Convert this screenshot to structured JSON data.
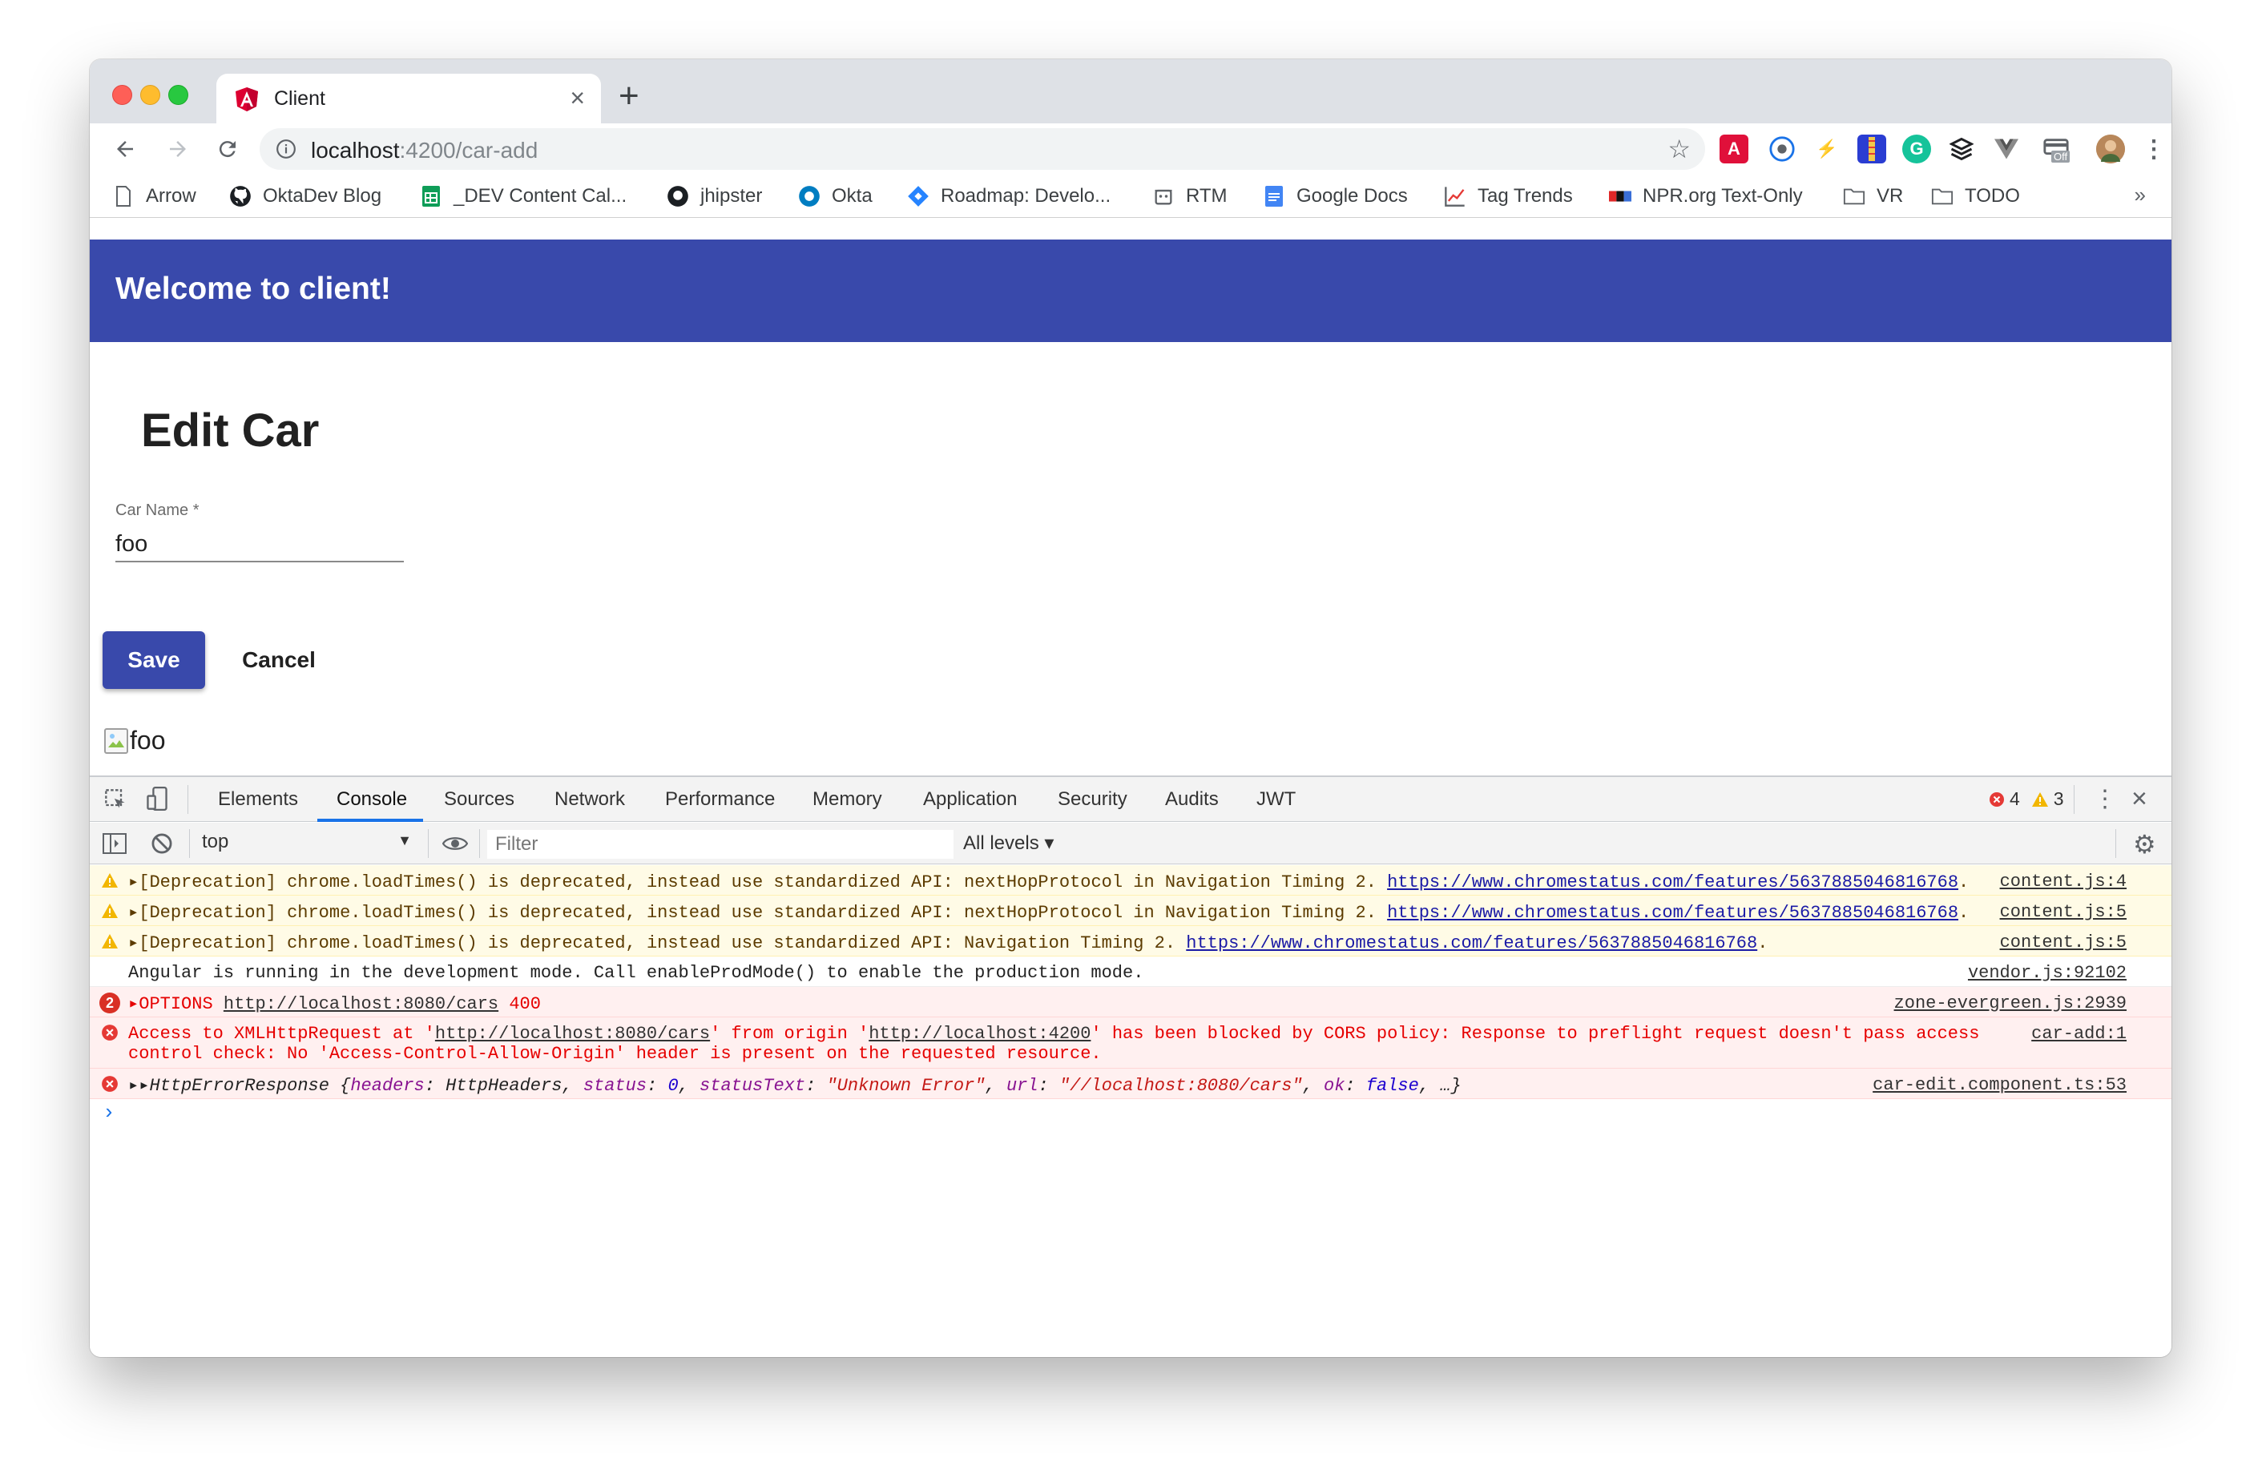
{
  "browser": {
    "tab_title": "Client",
    "new_tab": "+",
    "url_host": "localhost",
    "url_rest": ":4200/car-add",
    "bookmarks": [
      {
        "label": "Arrow",
        "icon": "page-icon"
      },
      {
        "label": "OktaDev Blog",
        "icon": "github-icon"
      },
      {
        "label": "_DEV Content Cal...",
        "icon": "sheets-icon"
      },
      {
        "label": "jhipster",
        "icon": "github-icon"
      },
      {
        "label": "Okta",
        "icon": "okta-icon"
      },
      {
        "label": "Roadmap: Develo...",
        "icon": "jira-icon"
      },
      {
        "label": "RTM",
        "icon": "rtm-icon"
      },
      {
        "label": "Google Docs",
        "icon": "docs-icon"
      },
      {
        "label": "Tag Trends",
        "icon": "chart-icon"
      },
      {
        "label": "NPR.org Text-Only",
        "icon": "npr-icon"
      },
      {
        "label": "VR",
        "icon": "folder-icon"
      },
      {
        "label": "TODO",
        "icon": "folder-icon"
      }
    ],
    "bookmarks_more": "»",
    "extension_off_label": "Off"
  },
  "app": {
    "header_title": "Welcome to client!",
    "page_title": "Edit Car",
    "field_label": "Car Name *",
    "field_value": "foo",
    "save_label": "Save",
    "cancel_label": "Cancel",
    "image_alt": "foo"
  },
  "devtools": {
    "tabs": [
      "Elements",
      "Console",
      "Sources",
      "Network",
      "Performance",
      "Memory",
      "Application",
      "Security",
      "Audits",
      "JWT"
    ],
    "active_tab": "Console",
    "error_count": "4",
    "warning_count": "3",
    "context": "top",
    "filter_placeholder": "Filter",
    "levels": "All levels ▾",
    "messages": [
      {
        "type": "warn",
        "text": "▸[Deprecation] chrome.loadTimes() is deprecated, instead use standardized API: nextHopProtocol in Navigation Timing 2. ",
        "link": "https://www.chromestatus.com/features/5637885046816768",
        "after": ".",
        "source": "content.js:4"
      },
      {
        "type": "warn",
        "text": "▸[Deprecation] chrome.loadTimes() is deprecated, instead use standardized API: nextHopProtocol in Navigation Timing 2. ",
        "link": "https://www.chromestatus.com/features/5637885046816768",
        "after": ".",
        "source": "content.js:5"
      },
      {
        "type": "warn",
        "text": "▸[Deprecation] chrome.loadTimes() is deprecated, instead use standardized API: Navigation Timing 2. ",
        "link": "https://www.chromestatus.com/features/5637885046816768",
        "after": ".",
        "source": "content.js:5"
      },
      {
        "type": "info",
        "text": "Angular is running in the development mode. Call enableProdMode() to enable the production mode.",
        "source": "vendor.js:92102"
      },
      {
        "type": "err-count",
        "count": "2",
        "text_a": "▸OPTIONS ",
        "link": "http://localhost:8080/cars",
        "text_b": " 400",
        "source": "zone-evergreen.js:2939"
      },
      {
        "type": "err",
        "text_a": "Access to XMLHttpRequest at '",
        "link_a": "http://localhost:8080/cars",
        "text_b": "' from origin '",
        "link_b": "http://localhost:4200",
        "text_c": "' has been blocked by CORS policy: Response to preflight request doesn't pass access",
        "line2": "control check: No 'Access-Control-Allow-Origin' header is present on the requested resource.",
        "source": "car-add:1"
      },
      {
        "type": "err-obj",
        "prefix": "▸▸HttpErrorResponse {",
        "k1": "headers",
        "v1": "HttpHeaders",
        "k2": "status",
        "v2": "0",
        "k3": "statusText",
        "v3": "\"Unknown Error\"",
        "k4": "url",
        "v4": "\"//localhost:8080/cars\"",
        "k5": "ok",
        "v5": "false",
        "suffix": ", …}",
        "source": "car-edit.component.ts:53"
      }
    ],
    "prompt": "›"
  },
  "colors": {
    "header": "#3949ab",
    "save_button": "#3949ab",
    "devtools_active": "#1a73e8"
  }
}
